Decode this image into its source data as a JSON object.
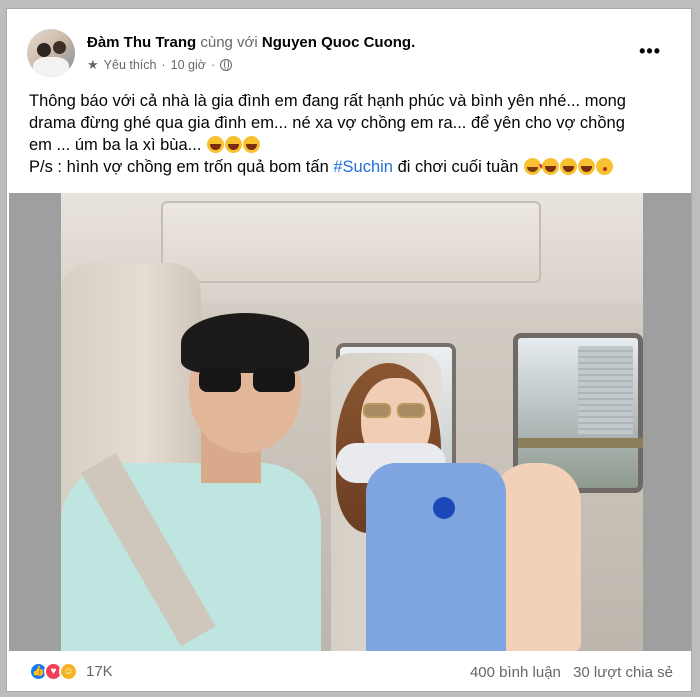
{
  "post": {
    "author": "Đàm Thu Trang",
    "with_text": "cùng với",
    "tagged": "Nguyen Quoc Cuong.",
    "meta_label": "Yêu thích",
    "separator": "·",
    "time": "10 giờ",
    "more_label": "•••",
    "text_line1": "Thông báo với cả nhà là gia đình em đang rất hạnh phúc và bình yên nhé... mong",
    "text_line2": "drama đừng ghé qua gia đình em... né xa vợ chồng em ra... để yên cho vợ chồng",
    "text_line3": "em ... úm ba la xì bùa...",
    "text_line4_prefix": "P/s : hình vợ chồng em trốn quả bom tấn",
    "hashtag": "#Suchin",
    "text_line4_suffix": "đi chơi cuối tuần"
  },
  "icons": {
    "more": "more-options-icon",
    "star": "star-icon",
    "globe": "globe-icon",
    "like": "like-reaction-icon",
    "heart": "heart-reaction-icon",
    "haha": "haha-reaction-icon"
  },
  "footer": {
    "reaction_count": "17K",
    "comments": "400 bình luận",
    "shares": "30 lượt chia sẻ"
  },
  "colors": {
    "hashtag": "#216fdb",
    "like": "#1877f2",
    "heart": "#f33e58",
    "haha": "#f7b125",
    "secondary_text": "#65676b"
  }
}
